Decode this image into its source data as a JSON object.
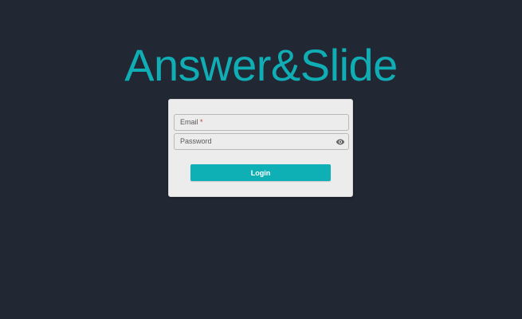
{
  "app": {
    "title": "Answer&Slide"
  },
  "login_form": {
    "email": {
      "label": "Email",
      "required_marker": "*",
      "value": ""
    },
    "password": {
      "label": "Password",
      "value": "",
      "visibility_icon": "eye-icon"
    },
    "submit_label": "Login"
  },
  "colors": {
    "background": "#212833",
    "accent": "#10adb5",
    "card": "#ececec"
  }
}
